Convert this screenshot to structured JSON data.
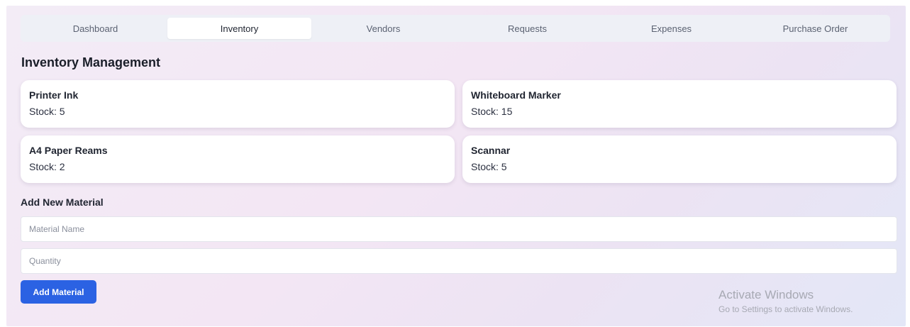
{
  "nav": {
    "tabs": [
      {
        "label": "Dashboard"
      },
      {
        "label": "Inventory"
      },
      {
        "label": "Vendors"
      },
      {
        "label": "Requests"
      },
      {
        "label": "Expenses"
      },
      {
        "label": "Purchase Order"
      }
    ],
    "active_tab": "Inventory"
  },
  "page": {
    "title": "Inventory Management"
  },
  "inventory": {
    "items": [
      {
        "name": "Printer Ink",
        "stock": "Stock: 5"
      },
      {
        "name": "Whiteboard Marker",
        "stock": "Stock: 15"
      },
      {
        "name": "A4 Paper Reams",
        "stock": "Stock: 2"
      },
      {
        "name": "Scannar",
        "stock": "Stock: 5"
      }
    ]
  },
  "add_form": {
    "title": "Add New Material",
    "name_placeholder": "Material Name",
    "quantity_placeholder": "Quantity",
    "submit_label": "Add Material"
  },
  "watermark": {
    "title": "Activate Windows",
    "subtitle": "Go to Settings to activate Windows."
  },
  "colors": {
    "accent": "#2b62e3",
    "tab_bar_bg": "#eef0f6"
  }
}
